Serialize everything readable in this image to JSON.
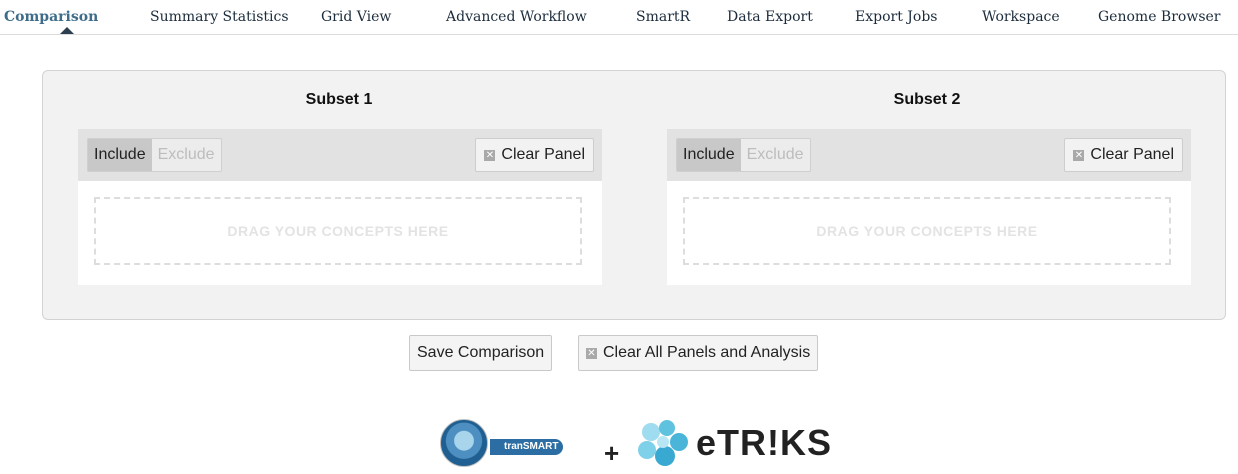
{
  "nav": {
    "tabs": [
      {
        "label": "Comparison",
        "active": true
      },
      {
        "label": "Summary Statistics"
      },
      {
        "label": "Grid View"
      },
      {
        "label": "Advanced Workflow"
      },
      {
        "label": "SmartR"
      },
      {
        "label": "Data Export"
      },
      {
        "label": "Export Jobs"
      },
      {
        "label": "Workspace"
      },
      {
        "label": "Genome Browser"
      }
    ]
  },
  "subsets": [
    {
      "title": "Subset 1",
      "include_label": "Include",
      "exclude_label": "Exclude",
      "mode": "Include",
      "clear_label": "Clear Panel",
      "dropzone_text": "DRAG YOUR CONCEPTS HERE"
    },
    {
      "title": "Subset 2",
      "include_label": "Include",
      "exclude_label": "Exclude",
      "mode": "Include",
      "clear_label": "Clear Panel",
      "dropzone_text": "DRAG YOUR CONCEPTS HERE"
    }
  ],
  "actions": {
    "save_label": "Save Comparison",
    "clear_all_label": "Clear All Panels and Analysis"
  },
  "footer": {
    "transmart_text": "tranSMART",
    "plus": "+",
    "etriks_text": "eTR!KS"
  },
  "icons": {
    "clear": "close-box-icon",
    "active_tab_marker": "caret-up-icon",
    "transmart_logo": "transmart-globe-icon",
    "etriks_logo": "etriks-puzzle-icon"
  },
  "colors": {
    "active_tab": "#3d6d8a",
    "container_bg": "#f2f2f2",
    "panel_header_bg": "#e2e2e2",
    "toggle_on_bg": "#c8c8c8",
    "etriks_accent": "#5fc3e0",
    "transmart_blue": "#2c6ea4"
  }
}
